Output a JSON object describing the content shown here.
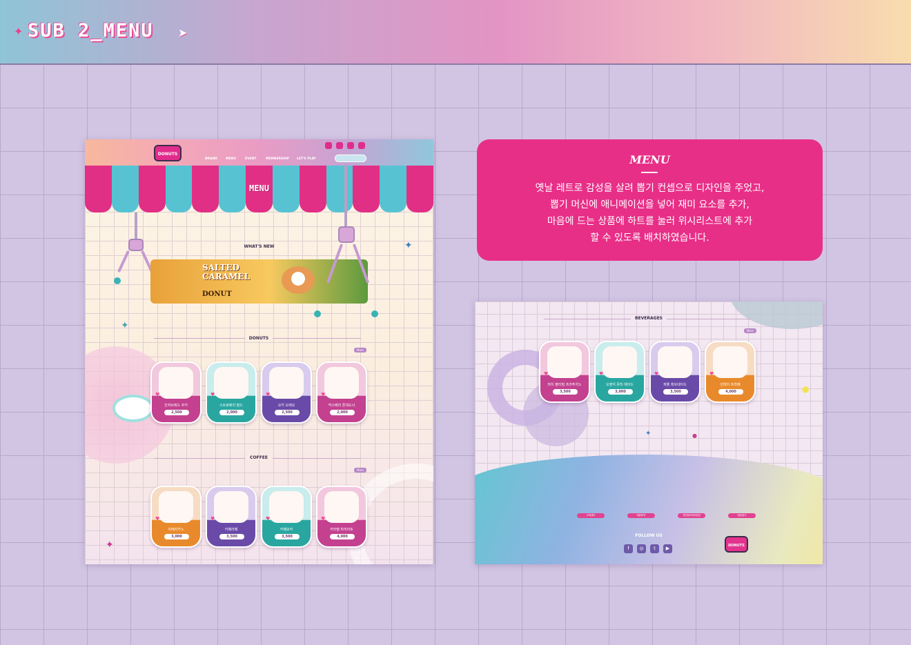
{
  "header": {
    "title": "SUB 2_MENU",
    "sparkle_icon": "sparkle-icon",
    "cursor_icon": "pointer-cursor-icon"
  },
  "left_mock": {
    "nav": {
      "logo": "DONUTS",
      "items": [
        "BRAND",
        "MENU",
        "EVENT",
        "MEMBERSHIP",
        "LET'S PLAY"
      ]
    },
    "page_title": "MENU",
    "whats_new": {
      "label": "WHAT'S NEW",
      "banner_line1": "SALTED",
      "banner_line2": "CARAMEL",
      "banner_line3": "DONUT"
    },
    "donuts": {
      "label": "DONUTS",
      "more": "More",
      "items": [
        {
          "name": "진저브레드 쿠키",
          "price": "2,500"
        },
        {
          "name": "스트로베리 필드",
          "price": "2,000"
        },
        {
          "name": "오키 오레오",
          "price": "2,500"
        },
        {
          "name": "믹스베리 폰데도너",
          "price": "2,000"
        }
      ]
    },
    "coffee": {
      "label": "COFFEE",
      "more": "More",
      "items": [
        {
          "name": "아메리카노",
          "price": "3,000"
        },
        {
          "name": "카페라떼",
          "price": "3,500"
        },
        {
          "name": "카페모카",
          "price": "3,500"
        },
        {
          "name": "카라멜 마끼아또",
          "price": "4,000"
        }
      ]
    }
  },
  "info": {
    "heading": "MENU",
    "lines": [
      "옛날 레트로 감성을 살려 뽑기 컨셉으로 디자인을 주었고,",
      "뽑기 머신에 애니메이션을 넣어 재미 요소를 추가,",
      "마음에 드는 상품에 하트를 눌러 위시리스트에  추가",
      "할 수 있도록 배치하였습니다."
    ]
  },
  "right_mock": {
    "beverages": {
      "label": "BEVERAGES",
      "more": "More",
      "items": [
        {
          "name": "피치 블라썸 프라푸치노",
          "price": "3,500"
        },
        {
          "name": "오렌지 뮤직 에이드",
          "price": "3,000"
        },
        {
          "name": "퍼플 레모네이드",
          "price": "3,500"
        },
        {
          "name": "선데이 프라페",
          "price": "4,000"
        }
      ]
    },
    "footer_links": [
      "고객센터",
      "제휴문의",
      "개인정보처리방침",
      "매장찾기"
    ],
    "follow_us": "FOLLOW US",
    "socials": [
      "facebook-icon",
      "instagram-icon",
      "twitter-icon",
      "youtube-icon"
    ],
    "logo": "DONUTS"
  },
  "colors": {
    "accent_pink": "#e82f88",
    "teal": "#57c3d2",
    "grid_bg": "#d2c5e3"
  }
}
